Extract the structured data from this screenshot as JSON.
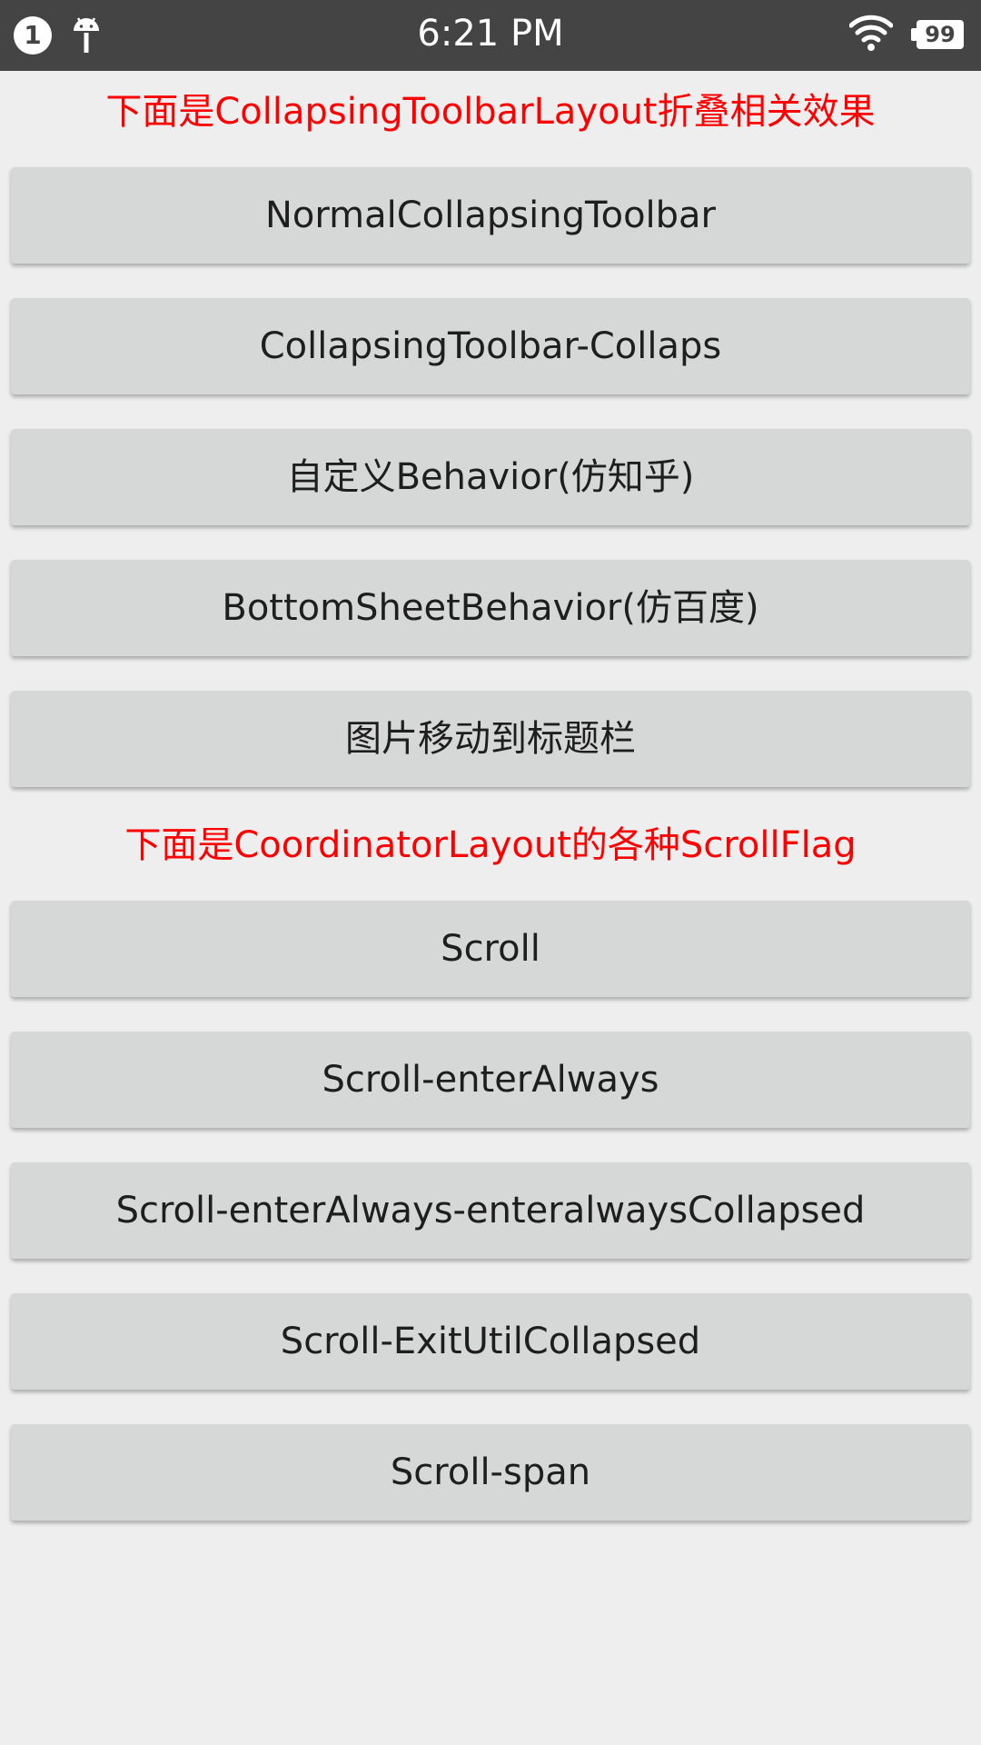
{
  "status_bar": {
    "notification_count": "1",
    "time": "6:21 PM",
    "battery": "99",
    "icons": [
      "notification-count-icon",
      "android-debug-icon",
      "wifi-icon",
      "battery-icon"
    ]
  },
  "sections": [
    {
      "label": "下面是CollapsingToolbarLayout折叠相关效果",
      "buttons": [
        "NormalCollapsingToolbar",
        "CollapsingToolbar-Collaps",
        "自定义Behavior(仿知乎)",
        "BottomSheetBehavior(仿百度)",
        "图片移动到标题栏"
      ]
    },
    {
      "label": "下面是CoordinatorLayout的各种ScrollFlag",
      "buttons": [
        "Scroll",
        "Scroll-enterAlways",
        "Scroll-enterAlways-enteralwaysCollapsed",
        "Scroll-ExitUtilCollapsed",
        "Scroll-span"
      ]
    }
  ],
  "colors": {
    "status_bar": "#444444",
    "background": "#eeeeee",
    "button": "#d6d7d7",
    "section_label": "#ff0000"
  }
}
